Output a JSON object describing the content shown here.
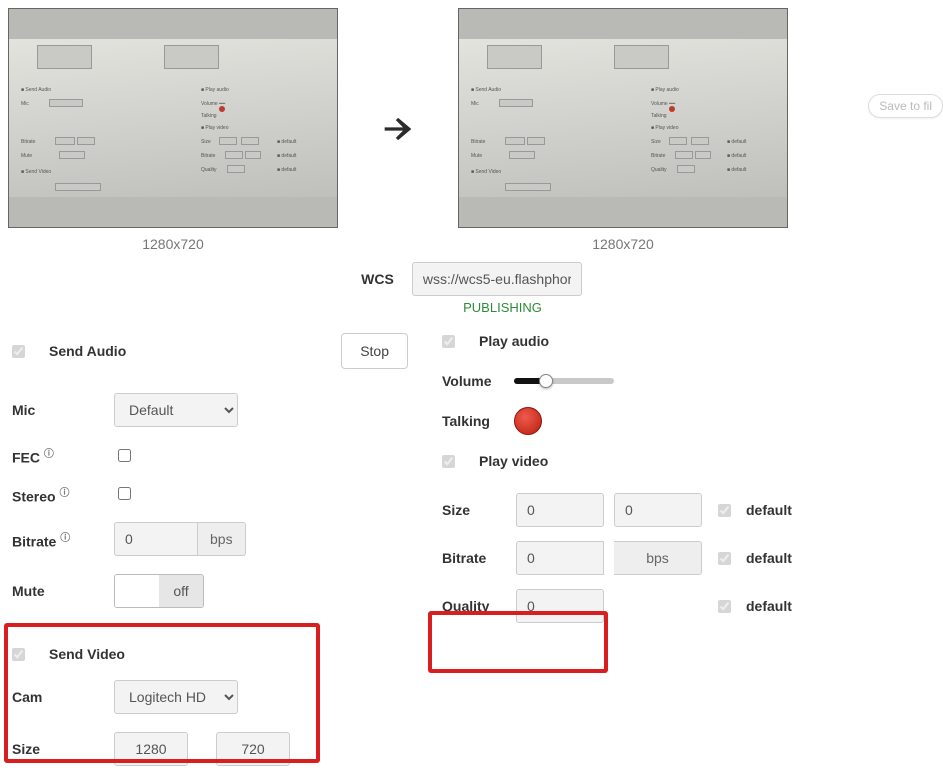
{
  "top": {
    "left_caption": "1280x720",
    "right_caption": "1280x720",
    "save_label": "Save to fil"
  },
  "wcs": {
    "label": "WCS",
    "url": "wss://wcs5-eu.flashphor",
    "status": "PUBLISHING"
  },
  "left": {
    "send_audio_label": "Send Audio",
    "stop_label": "Stop",
    "mic_label": "Mic",
    "mic_value": "Default",
    "fec_label": "FEC",
    "stereo_label": "Stereo",
    "bitrate_label": "Bitrate",
    "bitrate_value": "0",
    "bitrate_unit": "bps",
    "mute_label": "Mute",
    "mute_toggle": "off",
    "send_video_label": "Send Video",
    "cam_label": "Cam",
    "cam_value": "Logitech HD",
    "size_label": "Size",
    "size_w": "1280",
    "size_h": "720"
  },
  "right": {
    "play_audio_label": "Play audio",
    "volume_label": "Volume",
    "talking_label": "Talking",
    "play_video_label": "Play video",
    "size_label": "Size",
    "size_w": "0",
    "size_h": "0",
    "bitrate_label": "Bitrate",
    "bitrate_value": "0",
    "bitrate_unit": "bps",
    "quality_label": "Quality",
    "quality_value": "0",
    "default_label": "default"
  }
}
